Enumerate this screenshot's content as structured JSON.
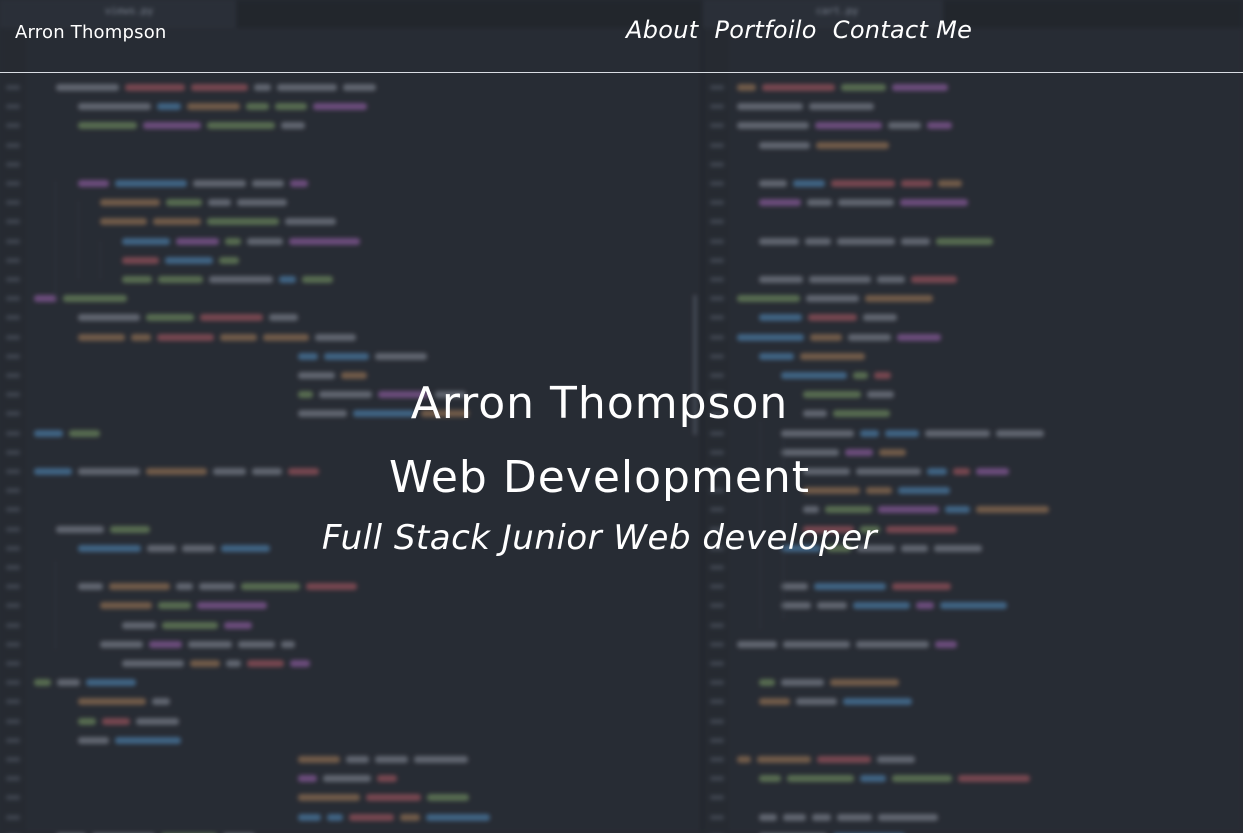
{
  "nav": {
    "brand": "Arron Thompson",
    "links": [
      {
        "label": "About"
      },
      {
        "label": "Portfoilo"
      },
      {
        "label": "Contact Me"
      }
    ]
  },
  "hero": {
    "name": "Arron Thompson",
    "title": "Web Development",
    "subtitle": "Full Stack Junior Web developer"
  },
  "background": {
    "left_tab": "views.py",
    "right_tab": "cart.py"
  },
  "colors": {
    "background": "#272c34",
    "text": "#ffffff",
    "keyword": "#c678dd",
    "function": "#61afef",
    "string": "#98c379",
    "attribute": "#e06c75",
    "plain": "#abb2bf",
    "number": "#d19a66"
  }
}
